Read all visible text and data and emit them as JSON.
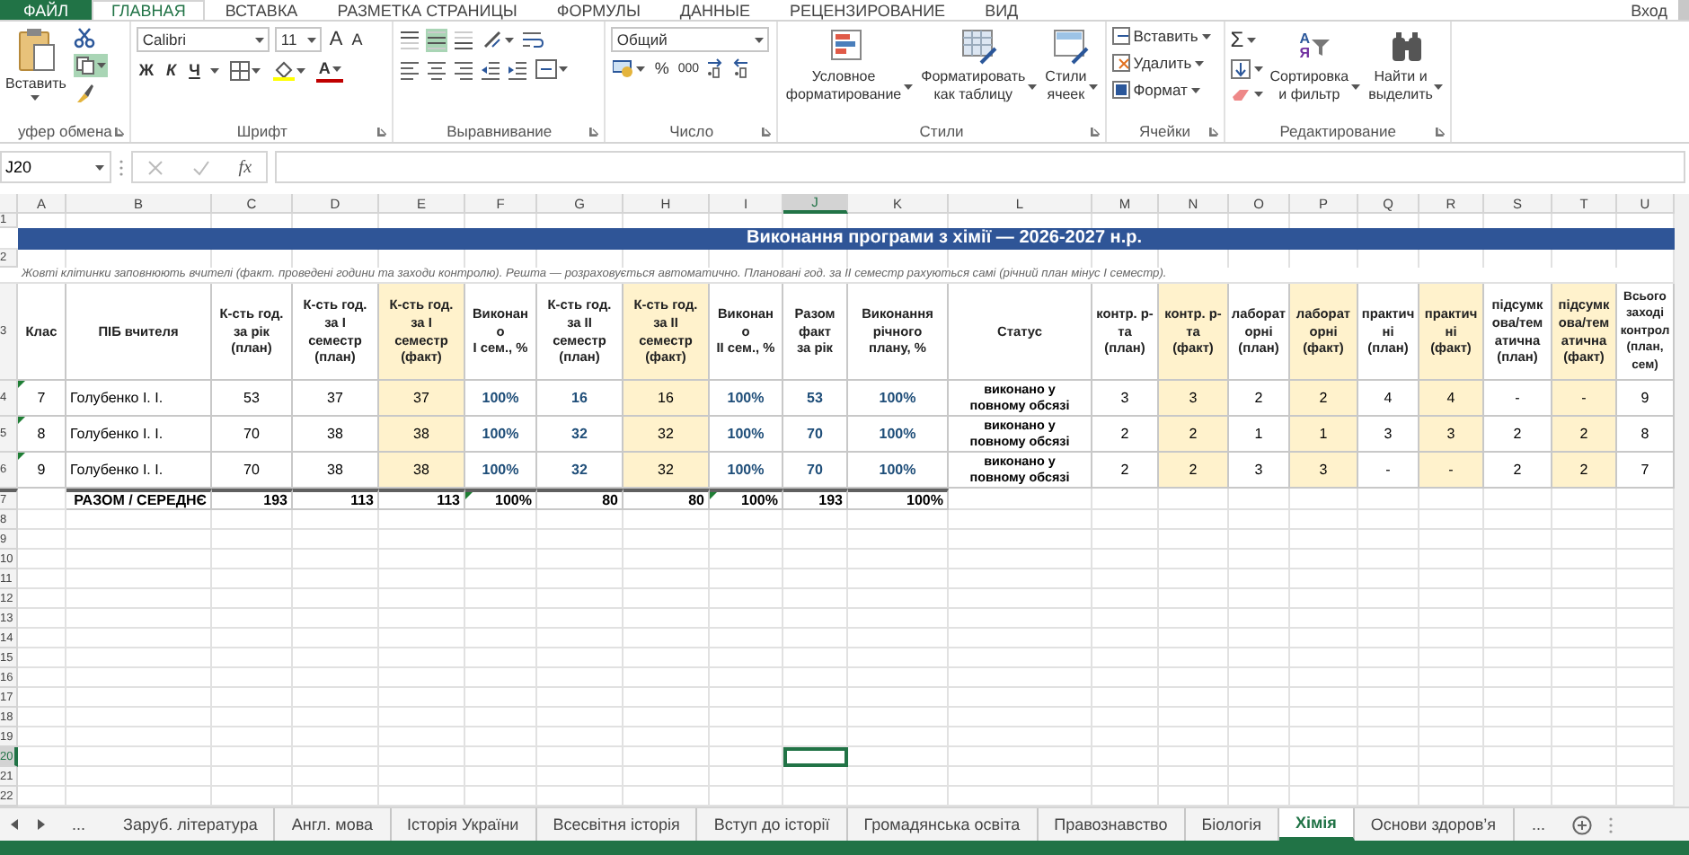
{
  "ribbon_tabs": [
    {
      "label": "ФАЙЛ",
      "kind": "file",
      "selected": false
    },
    {
      "label": "ГЛАВНАЯ",
      "kind": "tab",
      "selected": true
    },
    {
      "label": "ВСТАВКА",
      "kind": "tab",
      "selected": false
    },
    {
      "label": "РАЗМЕТКА СТРАНИЦЫ",
      "kind": "tab",
      "selected": false
    },
    {
      "label": "ФОРМУЛЫ",
      "kind": "tab",
      "selected": false
    },
    {
      "label": "ДАННЫЕ",
      "kind": "tab",
      "selected": false
    },
    {
      "label": "РЕЦЕНЗИРОВАНИЕ",
      "kind": "tab",
      "selected": false
    },
    {
      "label": "ВИД",
      "kind": "tab",
      "selected": false
    }
  ],
  "account": "Вход",
  "ribbon": {
    "clipboard": {
      "paste": "Вставить",
      "label": "уфер обмена"
    },
    "font": {
      "name": "Calibri",
      "size": "11",
      "grow": "A",
      "shrink": "A",
      "bold": "Ж",
      "italic": "К",
      "underline": "Ч",
      "color_letter": "A",
      "label": "Шрифт"
    },
    "alignment": {
      "vertical": [
        {
          "selected": false
        },
        {
          "selected": true
        },
        {
          "selected": false
        }
      ],
      "label": "Выравнивание"
    },
    "number": {
      "format": "Общий",
      "percent": "%",
      "thousands": "000",
      "label": "Число"
    },
    "styles": {
      "buttons": [
        [
          "Условное",
          "форматирование"
        ],
        [
          "Форматировать",
          "как таблицу"
        ],
        [
          "Стили",
          "ячеек"
        ]
      ],
      "label": "Стили"
    },
    "cells": {
      "buttons": [
        "Вставить",
        "Удалить",
        "Формат"
      ],
      "label": "Ячейки"
    },
    "editing": {
      "sum": "Σ",
      "sort_letters": [
        "A",
        "Я"
      ],
      "buttons": [
        [
          "Сортировка",
          "и фильтр"
        ],
        [
          "Найти и",
          "выделить"
        ]
      ],
      "label": "Редактирование"
    }
  },
  "formula_bar": {
    "name_box": "J20",
    "fx": "fx"
  },
  "sheet": {
    "columns": [
      {
        "letter": "A",
        "selected": false
      },
      {
        "letter": "B",
        "selected": false
      },
      {
        "letter": "C",
        "selected": false
      },
      {
        "letter": "D",
        "selected": false
      },
      {
        "letter": "E",
        "selected": false
      },
      {
        "letter": "F",
        "selected": false
      },
      {
        "letter": "G",
        "selected": false
      },
      {
        "letter": "H",
        "selected": false
      },
      {
        "letter": "I",
        "selected": false
      },
      {
        "letter": "J",
        "selected": true
      },
      {
        "letter": "K",
        "selected": false
      },
      {
        "letter": "L",
        "selected": false
      },
      {
        "letter": "M",
        "selected": false
      },
      {
        "letter": "N",
        "selected": false
      },
      {
        "letter": "O",
        "selected": false
      },
      {
        "letter": "P",
        "selected": false
      },
      {
        "letter": "Q",
        "selected": false
      },
      {
        "letter": "R",
        "selected": false
      },
      {
        "letter": "S",
        "selected": false
      },
      {
        "letter": "T",
        "selected": false
      },
      {
        "letter": "U",
        "selected": false
      }
    ],
    "row_headers": [
      {
        "label": "1",
        "selected": false
      },
      {
        "label": "2",
        "selected": false
      },
      {
        "label": "3",
        "selected": false
      },
      {
        "label": "4",
        "selected": false
      },
      {
        "label": "5",
        "selected": false
      },
      {
        "label": "6",
        "selected": false
      },
      {
        "label": "7",
        "selected": false
      },
      {
        "label": "8",
        "selected": false
      },
      {
        "label": "9",
        "selected": false
      },
      {
        "label": "10",
        "selected": false
      },
      {
        "label": "11",
        "selected": false
      },
      {
        "label": "12",
        "selected": false
      },
      {
        "label": "13",
        "selected": false
      },
      {
        "label": "14",
        "selected": false
      },
      {
        "label": "15",
        "selected": false
      },
      {
        "label": "16",
        "selected": false
      },
      {
        "label": "17",
        "selected": false
      },
      {
        "label": "18",
        "selected": false
      },
      {
        "label": "19",
        "selected": false
      },
      {
        "label": "20",
        "selected": true
      },
      {
        "label": "21",
        "selected": false
      },
      {
        "label": "22",
        "selected": false
      }
    ],
    "title": "Виконання програми з хімії —  2026-2027 н.р.",
    "note": "Жовті клітинки заповнюють вчителі (факт. проведені години та заходи контролю). Решта — розраховується автоматично. Плановані год. за II семестр рахуються самі (річний план мінус I семестр).",
    "headers": [
      {
        "lines": [
          "Клас"
        ],
        "kind": "plain"
      },
      {
        "lines": [
          "ПІБ вчителя"
        ],
        "kind": "text"
      },
      {
        "lines": [
          "К-сть год.",
          "за рік",
          "(план)"
        ],
        "kind": "plain"
      },
      {
        "lines": [
          "К-сть год.",
          "за I",
          "семестр",
          "(план)"
        ],
        "kind": "plain"
      },
      {
        "lines": [
          "К-сть год.",
          "за I",
          "семестр",
          "(факт)"
        ],
        "kind": "input"
      },
      {
        "lines": [
          "Виконан",
          "о",
          "I сем., %"
        ],
        "kind": "computed"
      },
      {
        "lines": [
          "К-сть год.",
          "за II",
          "семестр",
          "(план)"
        ],
        "kind": "computed"
      },
      {
        "lines": [
          "К-сть год.",
          "за II",
          "семестр",
          "(факт)"
        ],
        "kind": "input"
      },
      {
        "lines": [
          "Виконан",
          "о",
          "II сем., %"
        ],
        "kind": "computed"
      },
      {
        "lines": [
          "Разом",
          "факт",
          "за рік"
        ],
        "kind": "computed"
      },
      {
        "lines": [
          "Виконання",
          "річного",
          "плану, %"
        ],
        "kind": "computed"
      },
      {
        "lines": [
          "Статус"
        ],
        "kind": "status"
      },
      {
        "lines": [
          "контр. р-",
          "та",
          "(план)"
        ],
        "kind": "plain"
      },
      {
        "lines": [
          "контр. р-",
          "та",
          "(факт)"
        ],
        "kind": "input"
      },
      {
        "lines": [
          "лаборат",
          "орні",
          "(план)"
        ],
        "kind": "plain"
      },
      {
        "lines": [
          "лаборат",
          "орні",
          "(факт)"
        ],
        "kind": "input"
      },
      {
        "lines": [
          "практич",
          "ні",
          "(план)"
        ],
        "kind": "plain"
      },
      {
        "lines": [
          "практич",
          "ні",
          "(факт)"
        ],
        "kind": "input"
      },
      {
        "lines": [
          "підсумк",
          "ова/тем",
          "атична",
          "(план)"
        ],
        "kind": "plain"
      },
      {
        "lines": [
          "підсумк",
          "ова/тем",
          "атична",
          "(факт)"
        ],
        "kind": "input"
      },
      {
        "lines": [
          "Всього",
          "заході",
          "контрол",
          "(план,",
          "сем)"
        ],
        "kind": "plain"
      }
    ],
    "data_rows": [
      {
        "flagged": true,
        "cells": [
          "7",
          "Голубенко І. І.",
          "53",
          "37",
          "37",
          "100%",
          "16",
          "16",
          "100%",
          "53",
          "100%",
          "виконано у повному обсязі",
          "3",
          "3",
          "2",
          "2",
          "4",
          "4",
          "-",
          "-",
          "9"
        ]
      },
      {
        "flagged": true,
        "cells": [
          "8",
          "Голубенко І. І.",
          "70",
          "38",
          "38",
          "100%",
          "32",
          "32",
          "100%",
          "70",
          "100%",
          "виконано у повному обсязі",
          "2",
          "2",
          "1",
          "1",
          "3",
          "3",
          "2",
          "2",
          "8"
        ]
      },
      {
        "flagged": true,
        "cells": [
          "9",
          "Голубенко І. І.",
          "70",
          "38",
          "38",
          "100%",
          "32",
          "32",
          "100%",
          "70",
          "100%",
          "виконано у повному обсязі",
          "2",
          "2",
          "3",
          "3",
          "-",
          "-",
          "2",
          "2",
          "7"
        ]
      }
    ],
    "totals": {
      "label": "РАЗОМ / СЕРЕДНЄ",
      "values": [
        {
          "text": "193",
          "flag": false
        },
        {
          "text": "113",
          "flag": false
        },
        {
          "text": "113",
          "flag": false
        },
        {
          "text": "100%",
          "flag": true
        },
        {
          "text": "80",
          "flag": false
        },
        {
          "text": "80",
          "flag": false
        },
        {
          "text": "100%",
          "flag": true
        },
        {
          "text": "193",
          "flag": false
        },
        {
          "text": "100%",
          "flag": false
        }
      ]
    }
  },
  "sheet_tabs": {
    "more_left": "...",
    "tabs": [
      {
        "label": "Заруб. література",
        "selected": false
      },
      {
        "label": "Англ. мова",
        "selected": false
      },
      {
        "label": "Історія України",
        "selected": false
      },
      {
        "label": "Всесвітня історія",
        "selected": false
      },
      {
        "label": "Вступ до історії",
        "selected": false
      },
      {
        "label": "Громадянська освіта",
        "selected": false
      },
      {
        "label": "Правознавство",
        "selected": false
      },
      {
        "label": "Біологія",
        "selected": false
      },
      {
        "label": "Хімія",
        "selected": true
      },
      {
        "label": "Основи здоров’я",
        "selected": false
      }
    ],
    "more_right": "..."
  }
}
